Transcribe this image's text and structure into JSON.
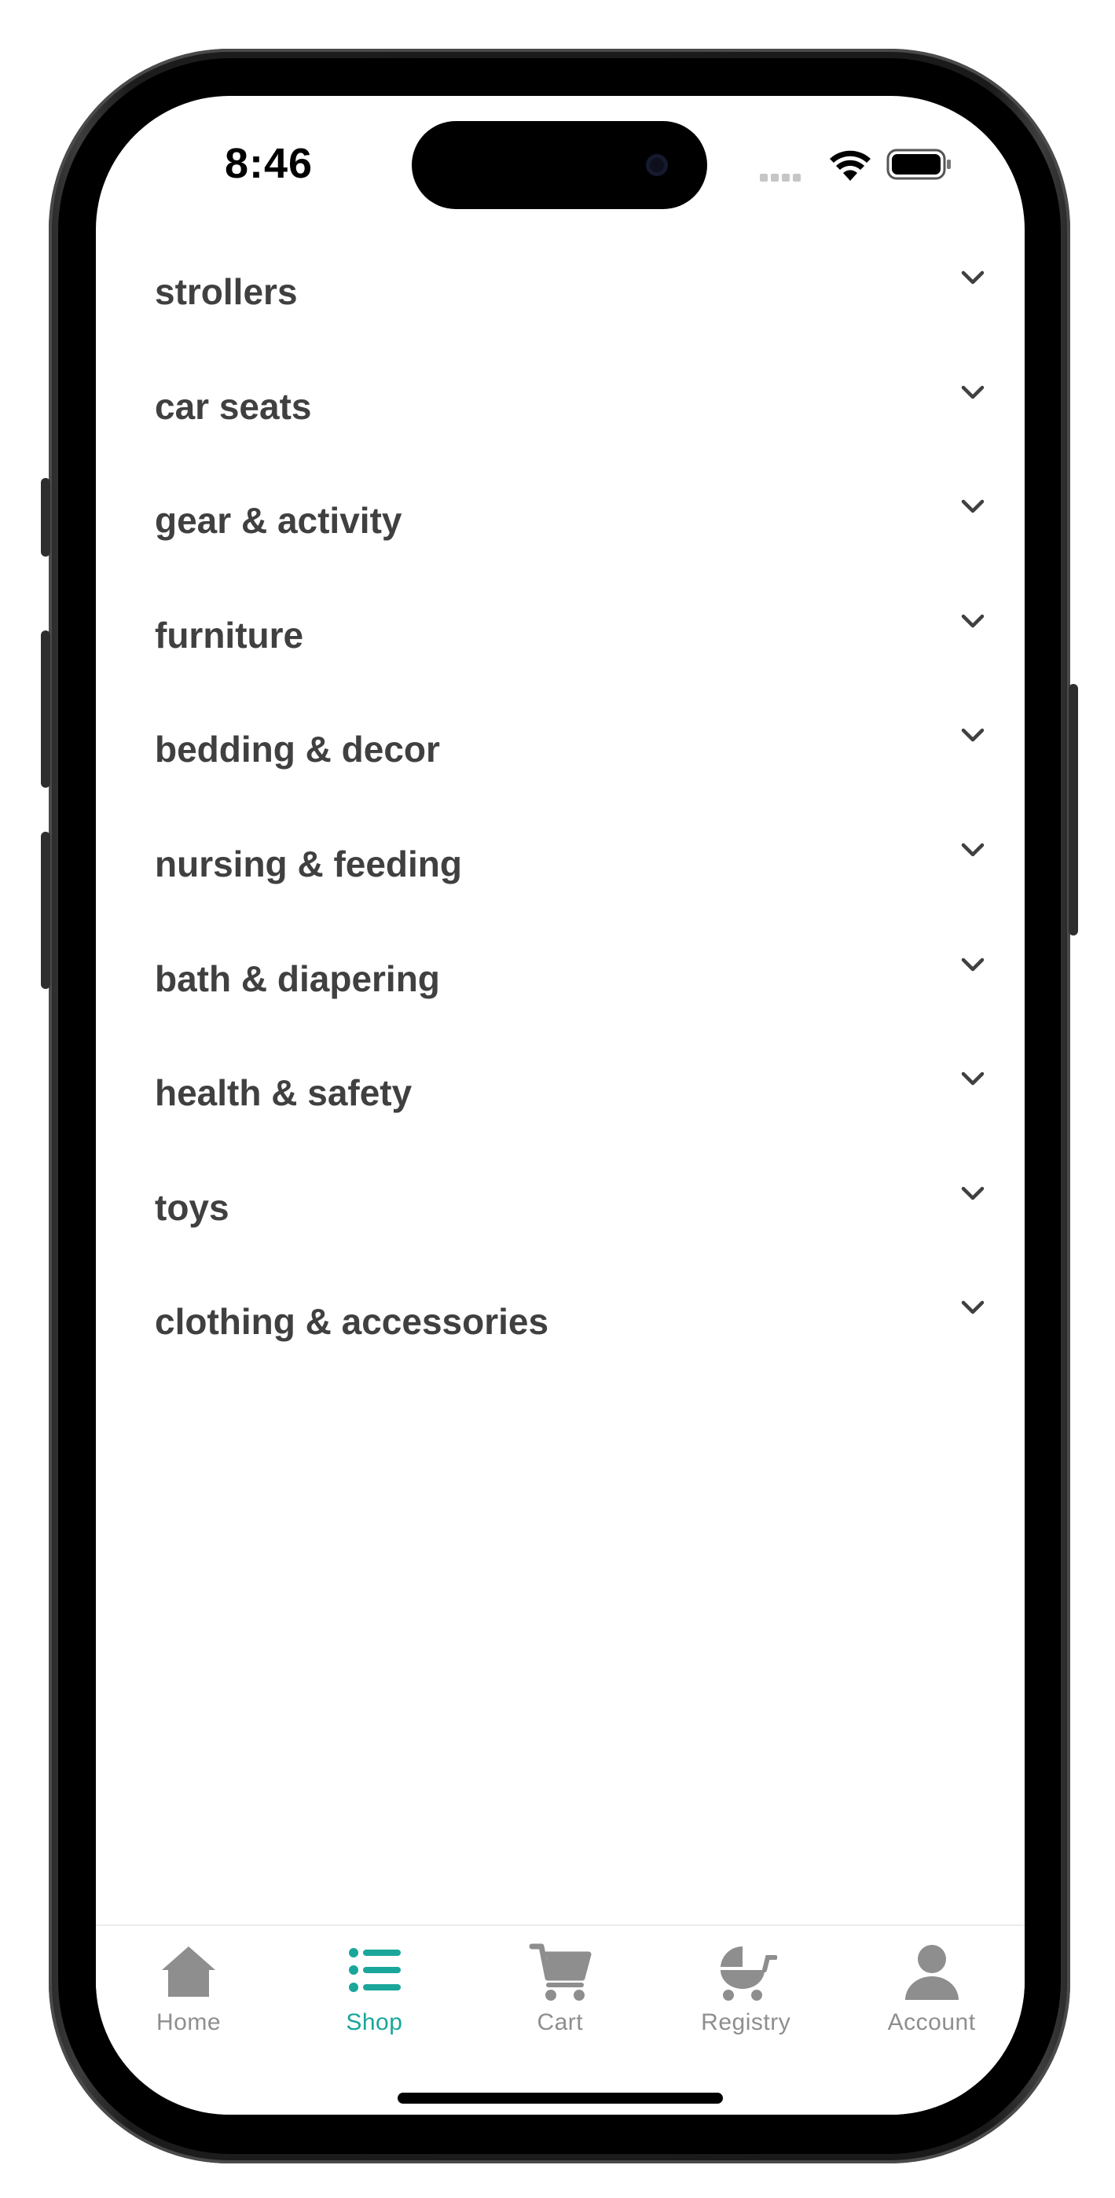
{
  "status_bar": {
    "time": "8:46"
  },
  "colors": {
    "accent": "#1aa69a",
    "label_text": "#404040",
    "tab_inactive": "#8e8e8e"
  },
  "categories": [
    {
      "label": "strollers",
      "icon": "chevron-down-icon"
    },
    {
      "label": "car seats",
      "icon": "chevron-down-icon"
    },
    {
      "label": "gear & activity",
      "icon": "chevron-down-icon"
    },
    {
      "label": "furniture",
      "icon": "chevron-down-icon"
    },
    {
      "label": "bedding & decor",
      "icon": "chevron-down-icon"
    },
    {
      "label": "nursing & feeding",
      "icon": "chevron-down-icon"
    },
    {
      "label": "bath & diapering",
      "icon": "chevron-down-icon"
    },
    {
      "label": "health & safety",
      "icon": "chevron-down-icon"
    },
    {
      "label": "toys",
      "icon": "chevron-down-icon"
    },
    {
      "label": "clothing & accessories",
      "icon": "chevron-down-icon"
    }
  ],
  "tab_bar": {
    "tabs": [
      {
        "label": "Home",
        "icon": "home-icon",
        "active": false
      },
      {
        "label": "Shop",
        "icon": "list-icon",
        "active": true
      },
      {
        "label": "Cart",
        "icon": "cart-icon",
        "active": false
      },
      {
        "label": "Registry",
        "icon": "baby-carriage-icon",
        "active": false
      },
      {
        "label": "Account",
        "icon": "user-icon",
        "active": false
      }
    ]
  }
}
